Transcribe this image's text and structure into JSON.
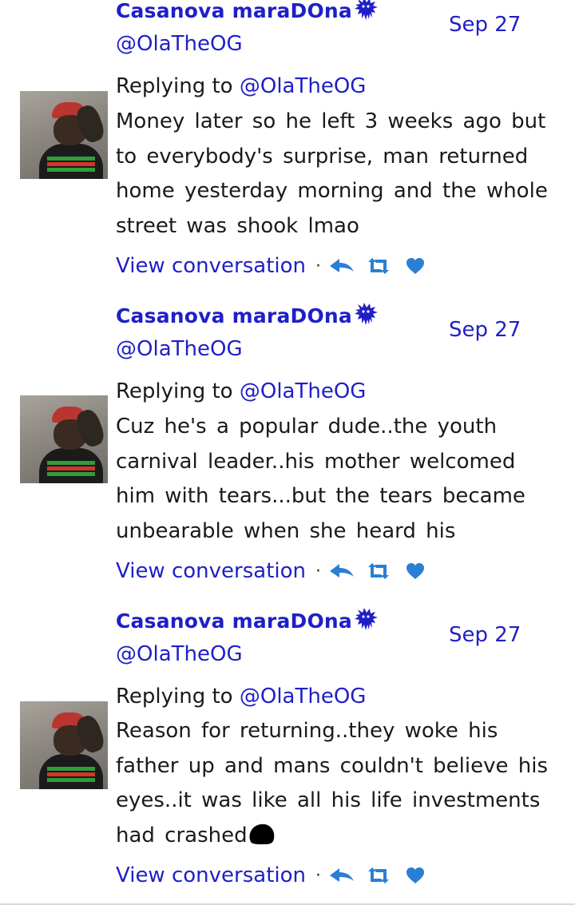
{
  "colors": {
    "link": "#1f1fc8",
    "text": "#1a1a1a",
    "action_icon": "#2a7fd4"
  },
  "tweets": [
    {
      "author_name": "Casanova maraDOna",
      "author_emoji": "shaggy-creature-emoji",
      "handle": "@OlaTheOG",
      "date": "Sep 27",
      "replying_prefix": "Replying to ",
      "replying_mention": "@OlaTheOG",
      "text": "Money later so he left 3 weeks ago but to everybody's surprise, man returned home yesterday morning and the whole street was shook lmao",
      "view_conversation": "View conversation"
    },
    {
      "author_name": "Casanova maraDOna",
      "author_emoji": "shaggy-creature-emoji",
      "handle": "@OlaTheOG",
      "date": "Sep 27",
      "replying_prefix": "Replying to ",
      "replying_mention": "@OlaTheOG",
      "text": "Cuz he's a popular dude..the youth carnival leader..his mother welcomed him with tears...but the tears became unbearable when she heard his",
      "view_conversation": "View conversation"
    },
    {
      "author_name": "Casanova maraDOna",
      "author_emoji": "shaggy-creature-emoji",
      "handle": "@OlaTheOG",
      "date": "Sep 27",
      "replying_prefix": "Replying to ",
      "replying_mention": "@OlaTheOG",
      "text": "Reason for returning..they woke his father up and mans couldn't believe his eyes..it was like all his life investments had crashed",
      "trailing_emoji": "black-blob-emoji",
      "view_conversation": "View conversation"
    }
  ],
  "icons": {
    "reply": "reply-icon",
    "retweet": "retweet-icon",
    "like": "heart-icon"
  }
}
